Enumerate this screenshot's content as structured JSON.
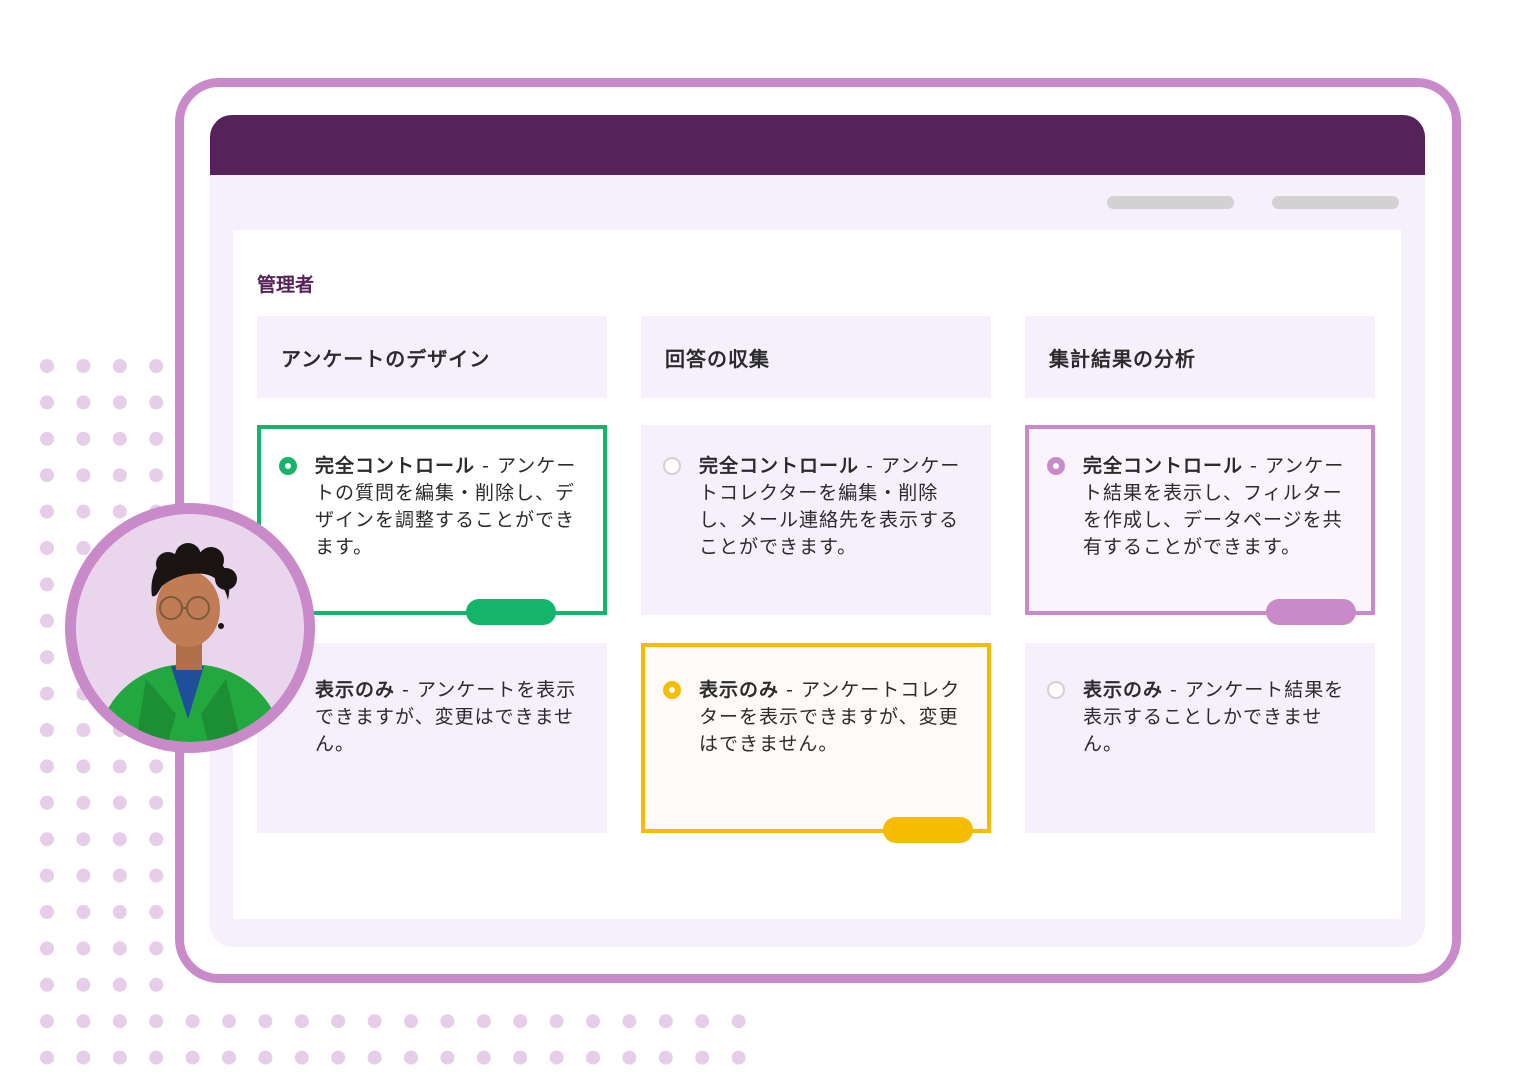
{
  "admin_label": "管理者",
  "columns": [
    {
      "label": "アンケートのデザイン"
    },
    {
      "label": "回答の収集"
    },
    {
      "label": "集計結果の分析"
    }
  ],
  "cards": {
    "design_full": {
      "title": "完全コントロール",
      "desc": " - アンケートの質問を編集・削除し、デザインを調整することができます。",
      "selected": true
    },
    "collect_full": {
      "title": "完全コントロール",
      "desc": " - アンケートコレクターを編集・削除し、メール連絡先を表示することができます。",
      "selected": false
    },
    "analyze_full": {
      "title": "完全コントロール",
      "desc": " - アンケート結果を表示し、フィルターを作成し、データページを共有することができます。",
      "selected": true
    },
    "design_view": {
      "title": "表示のみ",
      "desc": " - アンケートを表示できますが、変更はできません。",
      "selected": false
    },
    "collect_view": {
      "title": "表示のみ",
      "desc": " - アンケートコレクターを表示できますが、変更はできません。",
      "selected": true
    },
    "analyze_view": {
      "title": "表示のみ",
      "desc": " - アンケート結果を表示することしかできません。",
      "selected": false
    }
  },
  "colors": {
    "header": "#552259",
    "frame": "#c98ac9",
    "green": "#14b56a",
    "yellow": "#f5bc00",
    "purple": "#c98ac9"
  }
}
